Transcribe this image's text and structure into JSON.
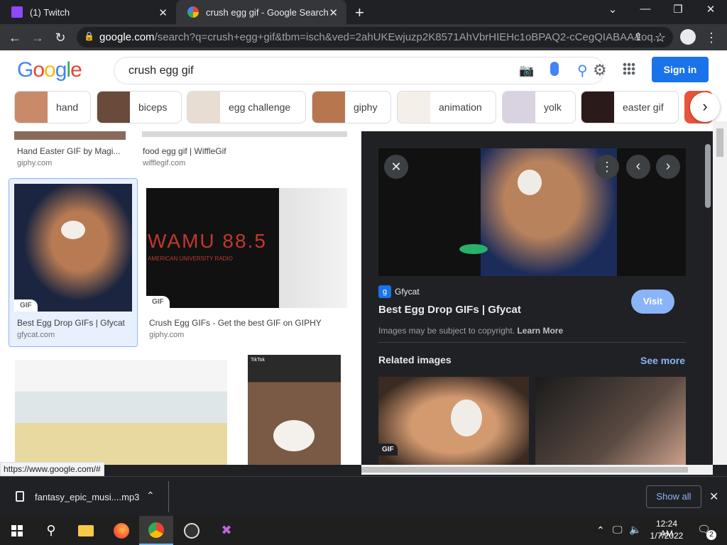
{
  "tabs": [
    {
      "label": "(1) Twitch",
      "favicon": "twitch-icon"
    },
    {
      "label": "crush egg gif - Google Search",
      "favicon": "google-icon"
    }
  ],
  "window_controls": {
    "minimize": "—",
    "maximize": "❐",
    "close": "✕",
    "tabsearch": "⌄"
  },
  "omnibox": {
    "domain": "google.com",
    "rest": "/search?q=crush+egg+gif&tbm=isch&ved=2ahUKEwjuzp2K8571AhVbrHIEHc1oBPAQ2-cCegQIABAA&oq..."
  },
  "google": {
    "logo_letters": [
      "G",
      "o",
      "o",
      "g",
      "l",
      "e"
    ],
    "logo_colors": [
      "#4285f4",
      "#ea4335",
      "#fbbc05",
      "#4285f4",
      "#34a853",
      "#ea4335"
    ],
    "query": "crush egg gif",
    "signin": "Sign in"
  },
  "chips": [
    {
      "label": "hand"
    },
    {
      "label": "biceps"
    },
    {
      "label": "egg challenge"
    },
    {
      "label": "giphy"
    },
    {
      "label": "animation"
    },
    {
      "label": "yolk"
    },
    {
      "label": "easter gif"
    }
  ],
  "results": {
    "top_row": [
      {
        "title": "Hand Easter GIF by Magi...",
        "source": "giphy.com"
      },
      {
        "title": "food egg gif | WiffleGif",
        "source": "wifflegif.com"
      }
    ],
    "mid_row": [
      {
        "title": "Best Egg Drop GIFs | Gfycat",
        "source": "gfycat.com",
        "badge": "GIF"
      },
      {
        "title": "Crush Egg GIFs - Get the best GIF on GIPHY",
        "source": "giphy.com",
        "badge": "GIF",
        "image_text": "WAMU 88.5",
        "image_sub": "AMERICAN UNIVERSITY RADIO"
      }
    ],
    "bottom_row": [
      {
        "overlay": "TikTok"
      }
    ]
  },
  "panel": {
    "source_name": "Gfycat",
    "title": "Best Egg Drop GIFs | Gfycat",
    "visit": "Visit",
    "copyright": "Images may be subject to copyright.",
    "learn_more": "Learn More",
    "related": "Related images",
    "see_more": "See more",
    "related_badge": "GIF"
  },
  "status_url": "https://www.google.com/#",
  "download": {
    "filename": "fantasy_epic_musi....mp3",
    "show_all": "Show all"
  },
  "taskbar": {
    "time": "12:24 AM",
    "date": "1/7/2022",
    "notifications": "2"
  }
}
